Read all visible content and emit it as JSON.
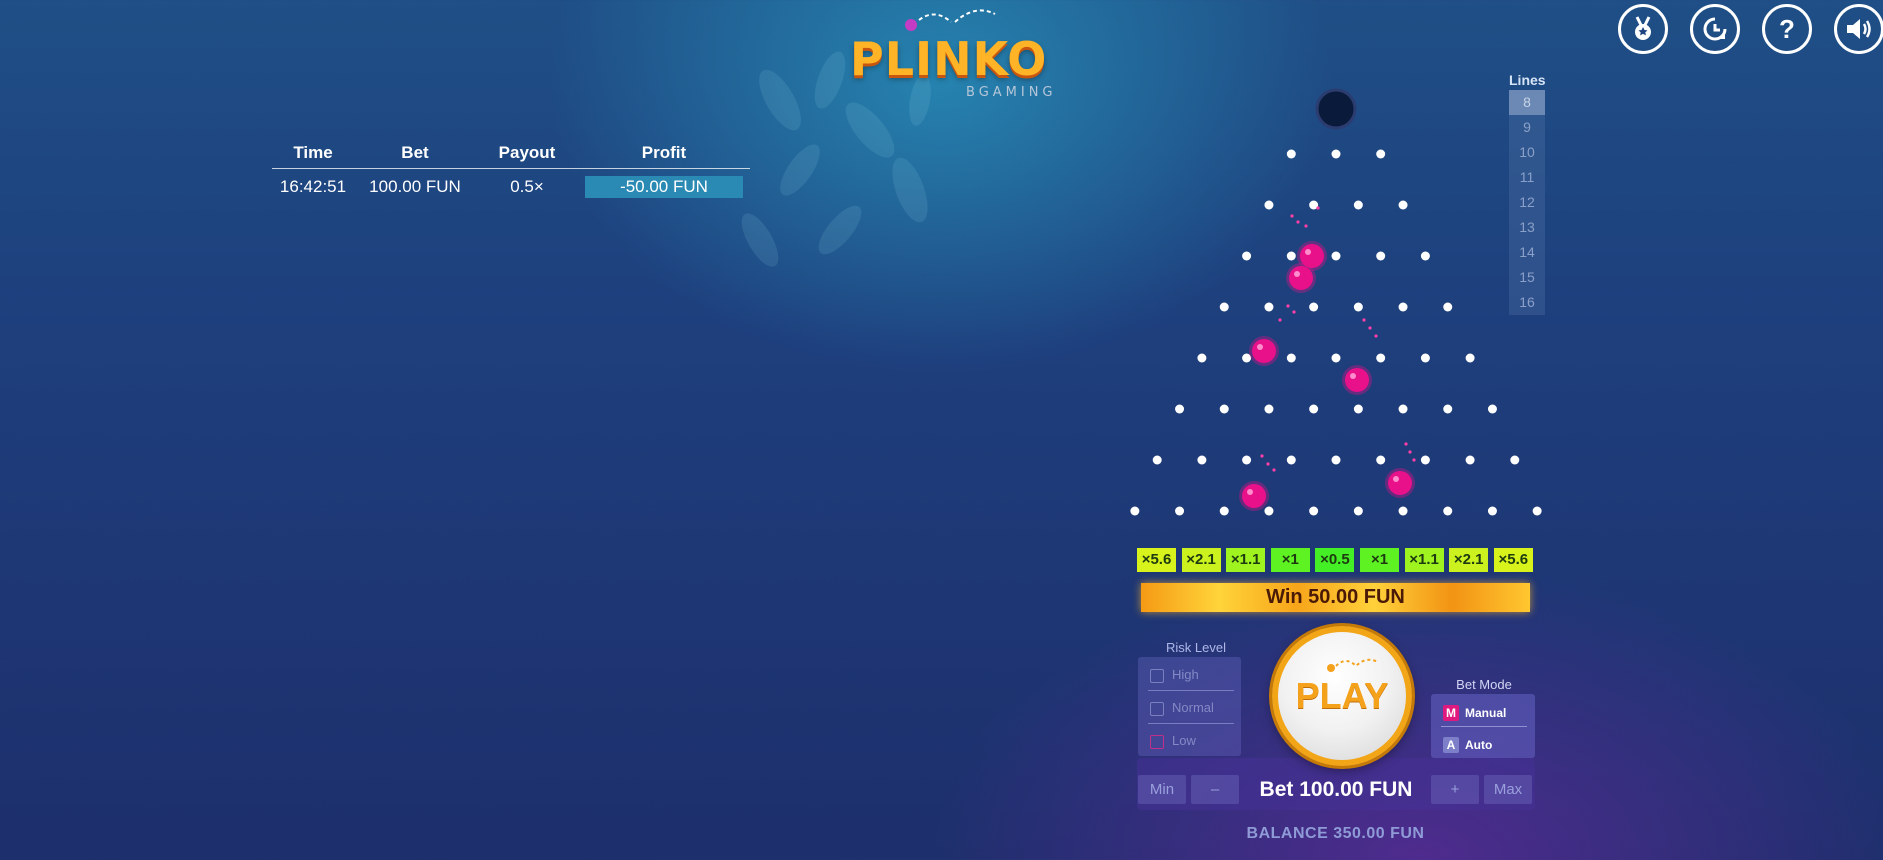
{
  "logo": {
    "title": "PLINKO",
    "subtitle": "BGAMING"
  },
  "history": {
    "headers": [
      "Time",
      "Bet",
      "Payout",
      "Profit"
    ],
    "rows": [
      {
        "time": "16:42:51",
        "bet": "100.00 FUN",
        "payout": "0.5×",
        "profit": "-50.00 FUN"
      }
    ]
  },
  "top_icons": [
    "medal-icon",
    "history-clock-icon",
    "help-icon",
    "speaker-icon"
  ],
  "top_icon_glyphs": {
    "help": "?"
  },
  "lines": {
    "title": "Lines",
    "options": [
      "8",
      "9",
      "10",
      "11",
      "12",
      "13",
      "14",
      "15",
      "16"
    ],
    "selected": "8"
  },
  "board": {
    "rows": 8,
    "multipliers": [
      "×5.6",
      "×2.1",
      "×1.1",
      "×1",
      "×0.5",
      "×1",
      "×1.1",
      "×2.1",
      "×5.6"
    ],
    "multiplier_colors": [
      "#d8f21b",
      "#cbf21e",
      "#9ff41f",
      "#5ef222",
      "#44f025",
      "#5ef222",
      "#9ff41f",
      "#cbf21e",
      "#d8f21b"
    ]
  },
  "win_text": "Win 50.00 FUN",
  "risk": {
    "title": "Risk Level",
    "options": [
      "High",
      "Normal",
      "Low"
    ],
    "selected": "Low"
  },
  "bet_mode": {
    "title": "Bet Mode",
    "options": [
      {
        "key": "M",
        "label": "Manual"
      },
      {
        "key": "A",
        "label": "Auto"
      }
    ],
    "selected": "Manual"
  },
  "play_label": "PLAY",
  "bet": {
    "min_label": "Min",
    "minus_label": "–",
    "plus_label": "+",
    "max_label": "Max",
    "display": "Bet 100.00 FUN"
  },
  "balance": "BALANCE 350.00 FUN",
  "colors": {
    "accent": "#f4a21c",
    "ball": "#e8118a",
    "profit_bg": "#2a8ab4"
  }
}
